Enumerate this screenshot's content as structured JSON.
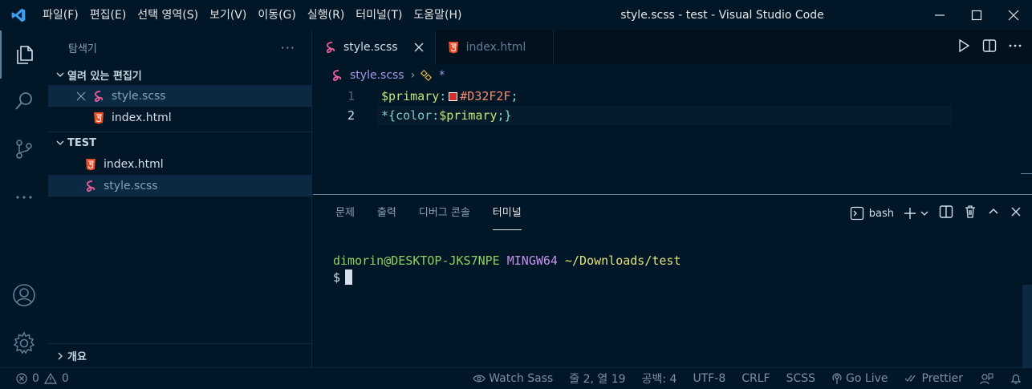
{
  "titlebar": {
    "menu": [
      "파일(F)",
      "편집(E)",
      "선택 영역(S)",
      "보기(V)",
      "이동(G)",
      "실행(R)",
      "터미널(T)",
      "도움말(H)"
    ],
    "window_title": "style.scss - test - Visual Studio Code"
  },
  "sidebar": {
    "title": "탐색기",
    "more": "···",
    "open_editors_label": "열려 있는 편집기",
    "open_editors": [
      {
        "label": "style.scss",
        "icon": "scss-file-icon"
      },
      {
        "label": "index.html",
        "icon": "html-file-icon"
      }
    ],
    "folder_label": "TEST",
    "files": [
      {
        "label": "index.html",
        "icon": "html-file-icon"
      },
      {
        "label": "style.scss",
        "icon": "scss-file-icon"
      }
    ],
    "outline_label": "개요"
  },
  "tabs": [
    {
      "label": "style.scss",
      "active": true
    },
    {
      "label": "index.html",
      "active": false
    }
  ],
  "breadcrumb": {
    "file": "style.scss",
    "symbol": "*"
  },
  "code": {
    "lines": [
      {
        "num": "1",
        "var": "$primary",
        "colon": ":",
        "value": "#D32F2F",
        "end": ";"
      },
      {
        "num": "2",
        "sel": "*{",
        "prop": "color",
        "colon": ":",
        "ref": "$primary",
        "end": ";}"
      }
    ],
    "swatch_color": "#D32F2F"
  },
  "panel": {
    "tabs": [
      "문제",
      "출력",
      "디버그 콘솔",
      "터미널"
    ],
    "active_tab": "터미널",
    "shell": "bash",
    "prompt_user": "dimorin@DESKTOP-JKS7NPE",
    "prompt_env": "MINGW64",
    "prompt_path": "~/Downloads/test",
    "prompt_symbol": "$"
  },
  "statusbar": {
    "errors": "0",
    "warnings": "0",
    "watch_sass": "Watch Sass",
    "position": "줄 2, 열 19",
    "spaces": "공백: 4",
    "encoding": "UTF-8",
    "eol": "CRLF",
    "language": "SCSS",
    "go_live": "Go Live",
    "prettier": "Prettier"
  },
  "colors": {
    "background": "#011627",
    "accent_scss": "#ec5f99",
    "accent_html": "#e44d26"
  }
}
